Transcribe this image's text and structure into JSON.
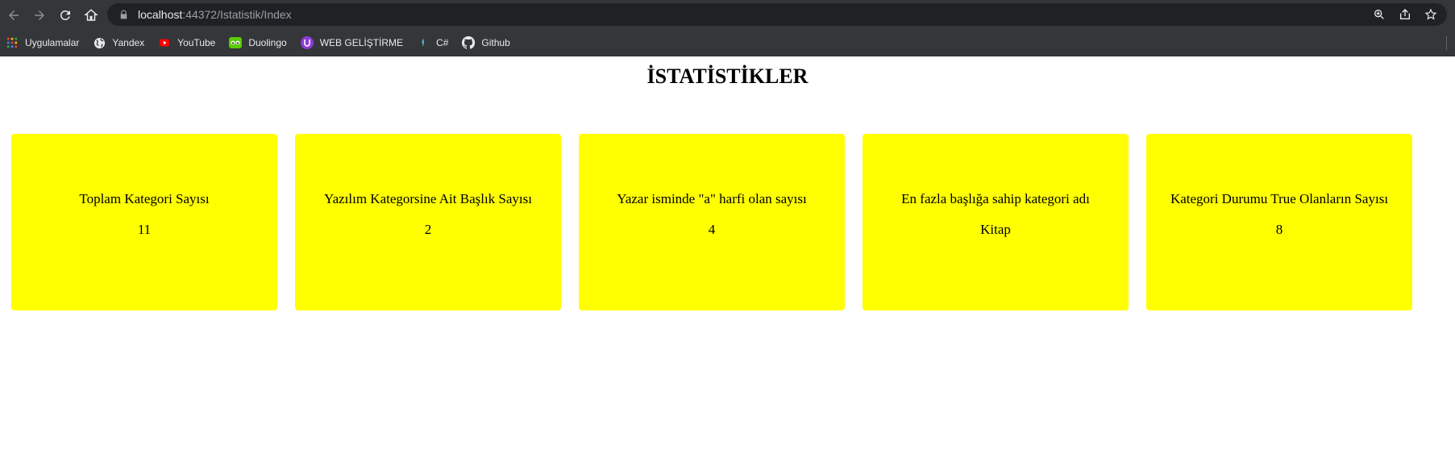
{
  "browser": {
    "url_host": "localhost",
    "url_path": ":44372/Istatistik/Index"
  },
  "bookmarks": [
    {
      "label": "Uygulamalar",
      "icon": "apps-grid-icon"
    },
    {
      "label": "Yandex",
      "icon": "globe-icon"
    },
    {
      "label": "YouTube",
      "icon": "youtube-icon"
    },
    {
      "label": "Duolingo",
      "icon": "duolingo-icon"
    },
    {
      "label": "WEB GELİŞTİRME",
      "icon": "web-dev-icon"
    },
    {
      "label": "C#",
      "icon": "csharp-icon"
    },
    {
      "label": "Github",
      "icon": "github-icon"
    }
  ],
  "page": {
    "title": "İSTATİSTİKLER"
  },
  "cards": [
    {
      "label": "Toplam Kategori Sayısı",
      "value": "11"
    },
    {
      "label": "Yazılım Kategorsine Ait Başlık Sayısı",
      "value": "2"
    },
    {
      "label": "Yazar isminde \"a\" harfi olan sayısı",
      "value": "4"
    },
    {
      "label": "En fazla başlığa sahip kategori adı",
      "value": "Kitap"
    },
    {
      "label": "Kategori Durumu True Olanların Sayısı",
      "value": "8"
    }
  ],
  "colors": {
    "card_background": "#ffff00",
    "chrome_background": "#35363a",
    "omnibox_background": "#202124"
  }
}
